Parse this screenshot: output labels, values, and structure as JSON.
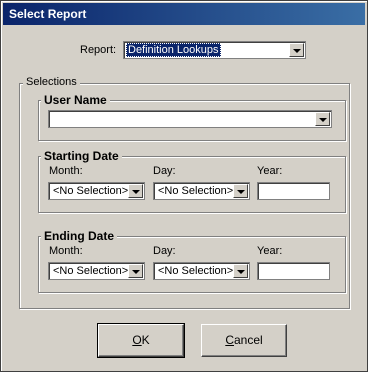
{
  "window": {
    "title": "Select Report"
  },
  "report": {
    "label": "Report:",
    "selected": "Definition Lookups"
  },
  "selections": {
    "legend": "Selections",
    "user_name": {
      "legend": "User Name",
      "selected": ""
    },
    "starting_date": {
      "legend": "Starting Date",
      "month_label": "Month:",
      "month_selected": "<No Selection>",
      "day_label": "Day:",
      "day_selected": "<No Selection>",
      "year_label": "Year:",
      "year_value": ""
    },
    "ending_date": {
      "legend": "Ending Date",
      "month_label": "Month:",
      "month_selected": "<No Selection>",
      "day_label": "Day:",
      "day_selected": "<No Selection>",
      "year_label": "Year:",
      "year_value": ""
    }
  },
  "buttons": {
    "ok_mnemonic": "O",
    "ok_rest": "K",
    "cancel_mnemonic": "C",
    "cancel_rest": "ancel"
  },
  "icons": {
    "dropdown": "chevron-down-icon"
  }
}
